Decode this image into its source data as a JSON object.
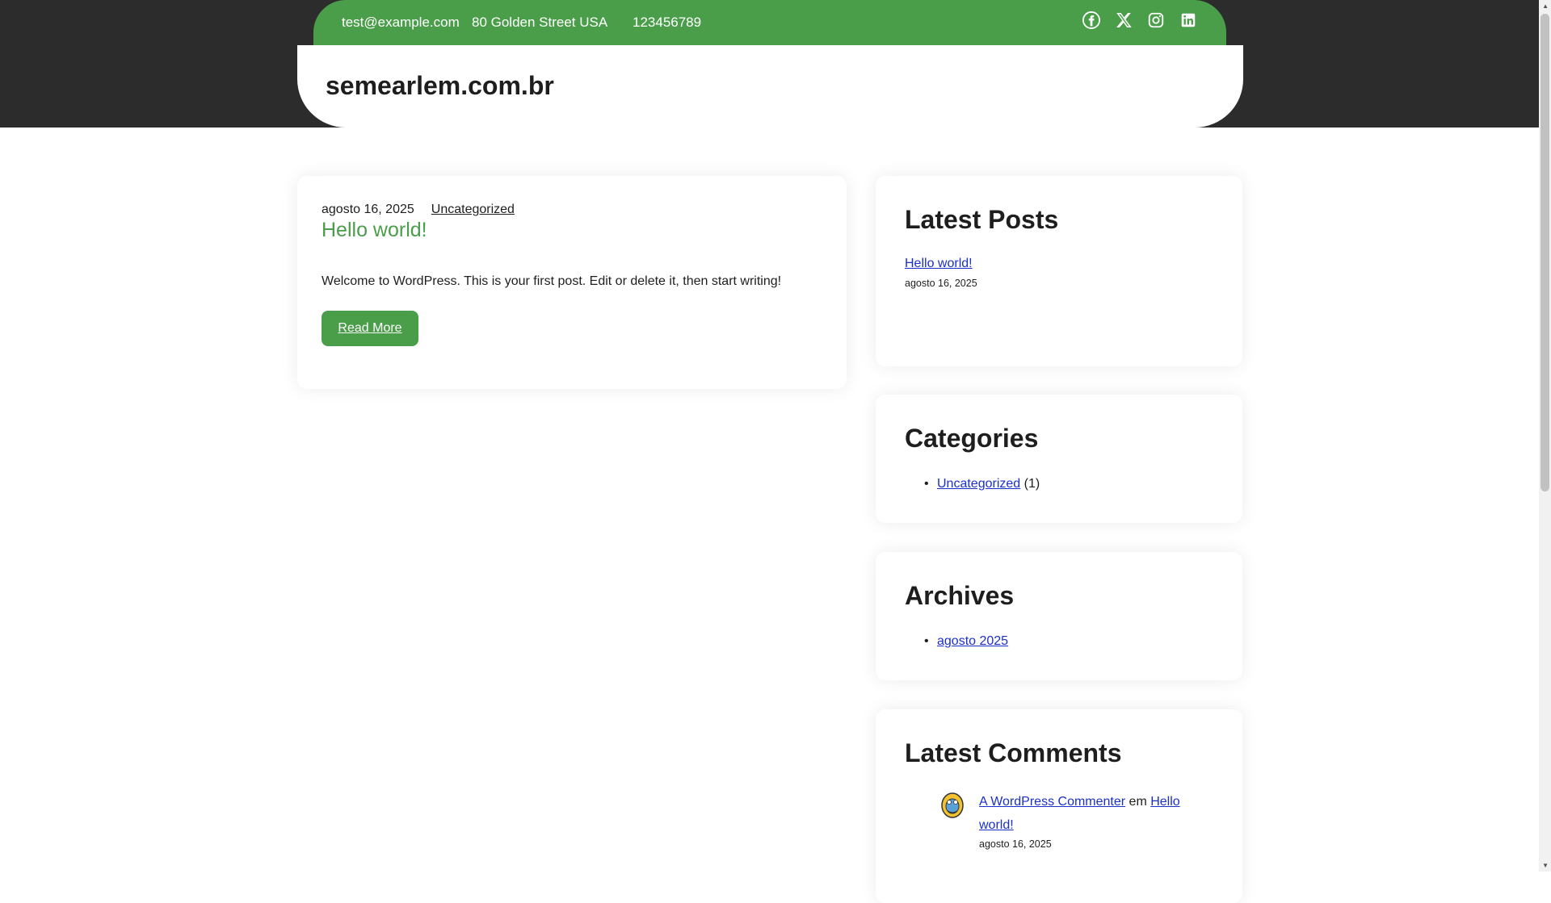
{
  "topbar": {
    "email": "test@example.com",
    "address": "80 Golden Street USA",
    "phone": "123456789",
    "socials": [
      "facebook-icon",
      "x-icon",
      "instagram-icon",
      "linkedin-icon"
    ]
  },
  "site": {
    "title": "semearlem.com.br"
  },
  "post": {
    "date": "agosto 16, 2025",
    "category": "Uncategorized",
    "title": "Hello world!",
    "excerpt": "Welcome to WordPress. This is your first post. Edit or delete it, then start writing!",
    "read_more": "Read More"
  },
  "widgets": {
    "latest_posts": {
      "title": "Latest Posts",
      "item_title": "Hello world!",
      "item_date": "agosto 16, 2025"
    },
    "categories": {
      "title": "Categories",
      "item": "Uncategorized",
      "count": "(1)"
    },
    "archives": {
      "title": "Archives",
      "item": "agosto 2025"
    },
    "latest_comments": {
      "title": "Latest Comments",
      "author": "A WordPress Commenter",
      "connector": "em",
      "post": "Hello world!",
      "date": "agosto 16, 2025"
    }
  },
  "colors": {
    "accent": "#4a9e4a",
    "header_dark": "#2c2c2c",
    "link": "#1a30c9"
  }
}
